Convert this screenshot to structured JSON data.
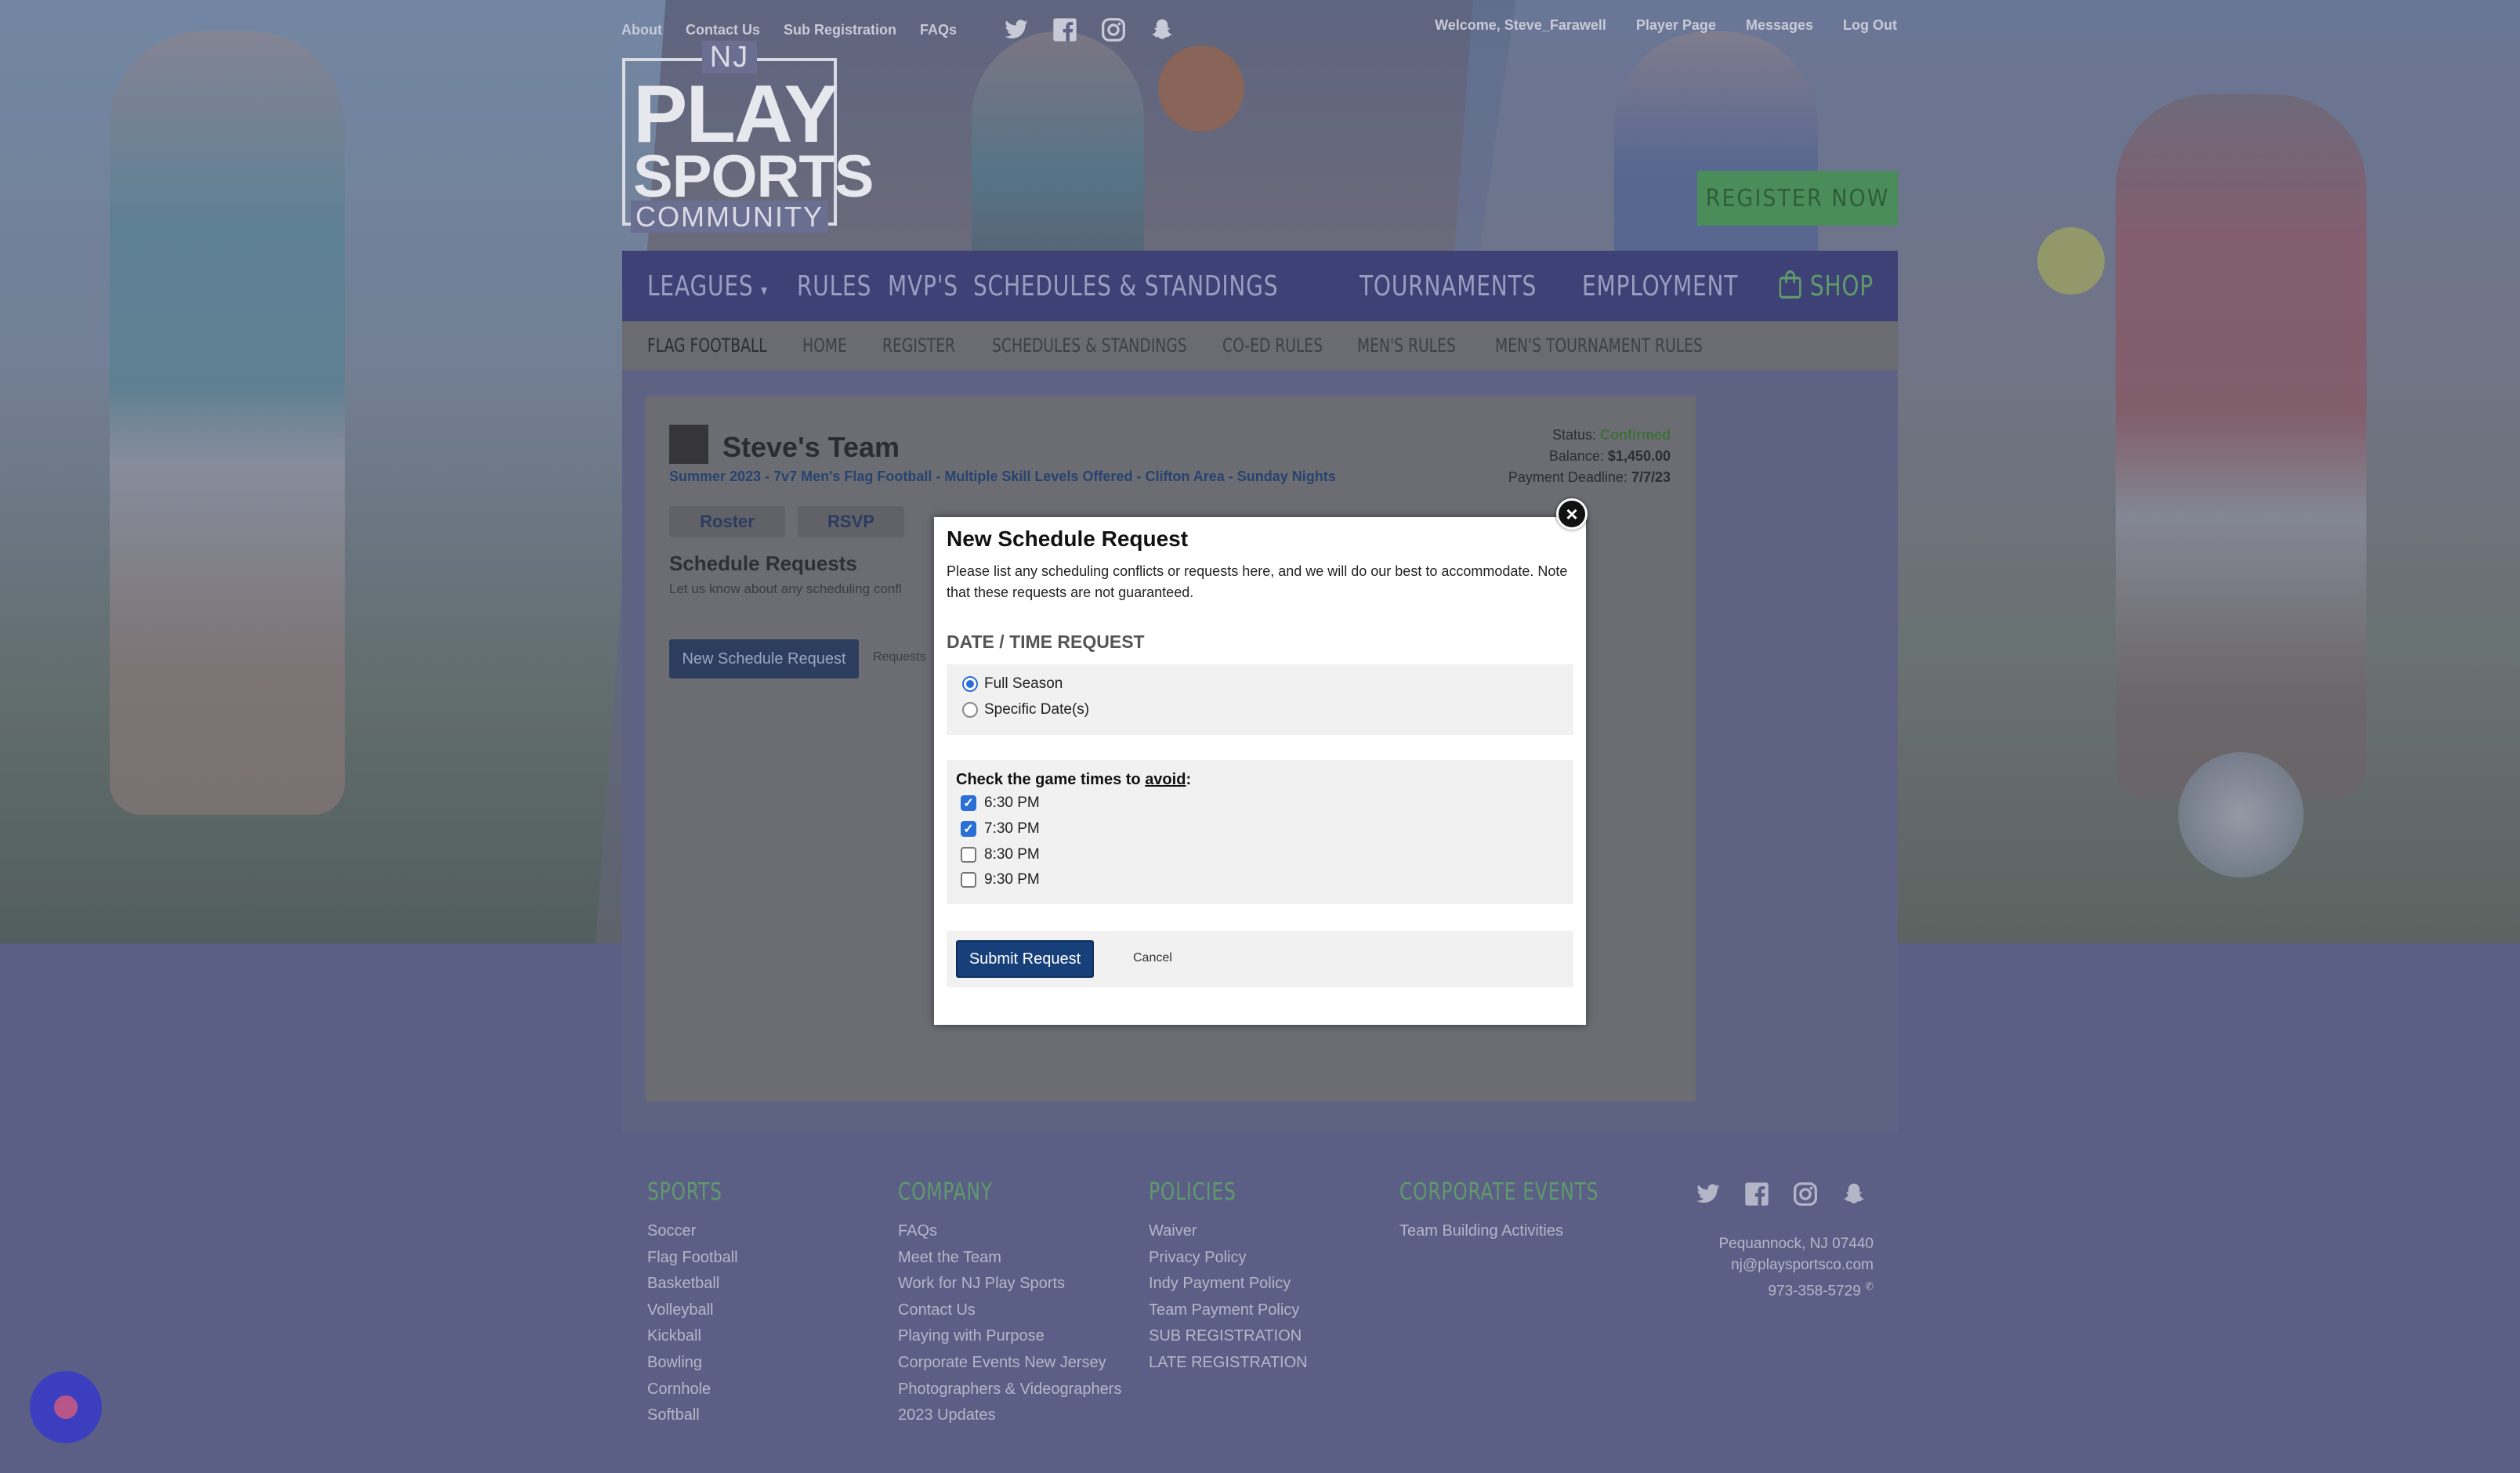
{
  "top_nav": {
    "links": [
      "About",
      "Contact Us",
      "Sub Registration",
      "FAQs"
    ],
    "welcome_prefix": "Welcome,",
    "username": "Steve_Farawell",
    "user_links": [
      "Player Page",
      "Messages",
      "Log Out"
    ]
  },
  "logo": {
    "line1": "NJ",
    "line2": "PLAY",
    "line3": "SPORTS",
    "line4": "COMMUNITY"
  },
  "register_now": "REGISTER NOW",
  "main_nav": [
    "LEAGUES",
    "RULES",
    "MVP'S",
    "SCHEDULES & STANDINGS",
    "TOURNAMENTS",
    "EMPLOYMENT",
    "SHOP"
  ],
  "sub_nav": [
    "FLAG FOOTBALL",
    "HOME",
    "REGISTER",
    "SCHEDULES & STANDINGS",
    "CO-ED RULES",
    "MEN'S RULES",
    "MEN'S TOURNAMENT RULES"
  ],
  "team": {
    "name": "Steve's Team",
    "league": "Summer 2023 - 7v7 Men's Flag Football - Multiple Skill Levels Offered - Clifton Area - Sunday Nights",
    "status_label": "Status:",
    "status_value": "Confirmed",
    "balance_label": "Balance:",
    "balance_value": "$1,450.00",
    "deadline_label": "Payment Deadline:",
    "deadline_value": "7/7/23",
    "tabs": [
      "Roster",
      "RSVP"
    ]
  },
  "schedule_requests": {
    "title": "Schedule Requests",
    "desc": "Let us know about any scheduling confl",
    "new_button": "New Schedule Request",
    "requests_label": "Requests"
  },
  "modal": {
    "title": "New Schedule Request",
    "desc": "Please list any scheduling conflicts or requests here, and we will do our best to accommodate. Note that these requests are not guaranteed.",
    "date_time_heading": "DATE / TIME REQUEST",
    "radio_options": [
      {
        "label": "Full Season",
        "checked": true
      },
      {
        "label": "Specific Date(s)",
        "checked": false
      }
    ],
    "times_heading_prefix": "Check the game times to",
    "times_heading_emphasis": "avoid",
    "times_heading_suffix": ":",
    "times": [
      {
        "label": "6:30 PM",
        "checked": true
      },
      {
        "label": "7:30 PM",
        "checked": true
      },
      {
        "label": "8:30 PM",
        "checked": false
      },
      {
        "label": "9:30 PM",
        "checked": false
      }
    ],
    "submit_label": "Submit Request",
    "cancel_label": "Cancel"
  },
  "footer": {
    "sports": {
      "heading": "SPORTS",
      "links": [
        "Soccer",
        "Flag Football",
        "Basketball",
        "Volleyball",
        "Kickball",
        "Bowling",
        "Cornhole",
        "Softball"
      ]
    },
    "company": {
      "heading": "COMPANY",
      "links": [
        "FAQs",
        "Meet the Team",
        "Work for NJ Play Sports",
        "Contact Us",
        "Playing with Purpose",
        "Corporate Events New Jersey",
        "Photographers & Videographers",
        "2023 Updates"
      ]
    },
    "policies": {
      "heading": "POLICIES",
      "links": [
        "Waiver",
        "Privacy Policy",
        "Indy Payment Policy",
        "Team Payment Policy",
        "SUB REGISTRATION",
        "LATE REGISTRATION"
      ]
    },
    "corporate": {
      "heading": "CORPORATE EVENTS",
      "links": [
        "Team Building Activities"
      ]
    },
    "contact": {
      "address": "Pequannock, NJ 07440",
      "email": "nj@playsportsco.com",
      "phone": "973-358-5729"
    }
  },
  "colors": {
    "accent_green": "#4b8d5a",
    "nav_blue": "#3d4175",
    "submit_blue": "#173f79",
    "status_green": "#3e6f3a"
  },
  "icons": [
    "twitter-icon",
    "facebook-icon",
    "instagram-icon",
    "snapchat-icon",
    "shopping-bag-icon",
    "close-icon",
    "chat-icon"
  ]
}
